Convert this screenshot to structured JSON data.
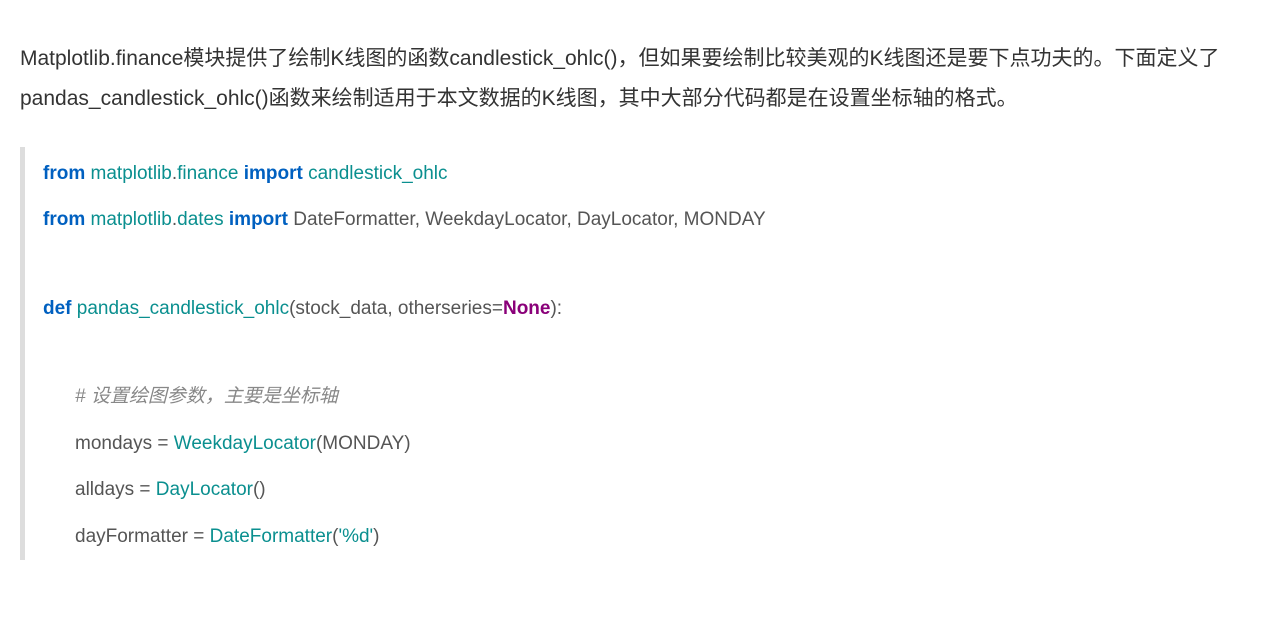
{
  "prose": {
    "paragraph": "Matplotlib.finance模块提供了绘制K线图的函数candlestick_ohlc()，但如果要绘制比较美观的K线图还是要下点功夫的。下面定义了pandas_candlestick_ohlc()函数来绘制适用于本文数据的K线图，其中大部分代码都是在设置坐标轴的格式。"
  },
  "code": {
    "line1": {
      "kw_from": "from",
      "mod1": "matplotlib",
      "dot1": ".",
      "mod2": "finance",
      "kw_import": "import",
      "name": "candlestick_ohlc"
    },
    "line2": {
      "kw_from": "from",
      "mod1": "matplotlib",
      "dot1": ".",
      "mod2": "dates",
      "kw_import": "import",
      "names": "DateFormatter, WeekdayLocator, DayLocator, MONDAY"
    },
    "line3": {
      "kw_def": "def",
      "fn": "pandas_candlestick_ohlc",
      "args_open": "(stock_data, otherseries=",
      "none": "None",
      "args_close": "):"
    },
    "comment": "# 设置绘图参数，主要是坐标轴",
    "line5": {
      "lhs": "mondays = ",
      "call": "WeekdayLocator",
      "paren": "(MONDAY)"
    },
    "line6": {
      "lhs": "alldays = ",
      "call": "DayLocator",
      "paren": "()"
    },
    "line7": {
      "lhs": "dayFormatter = ",
      "call": "DateFormatter",
      "paren_open": "(",
      "str": "'%d'",
      "paren_close": ")"
    }
  }
}
